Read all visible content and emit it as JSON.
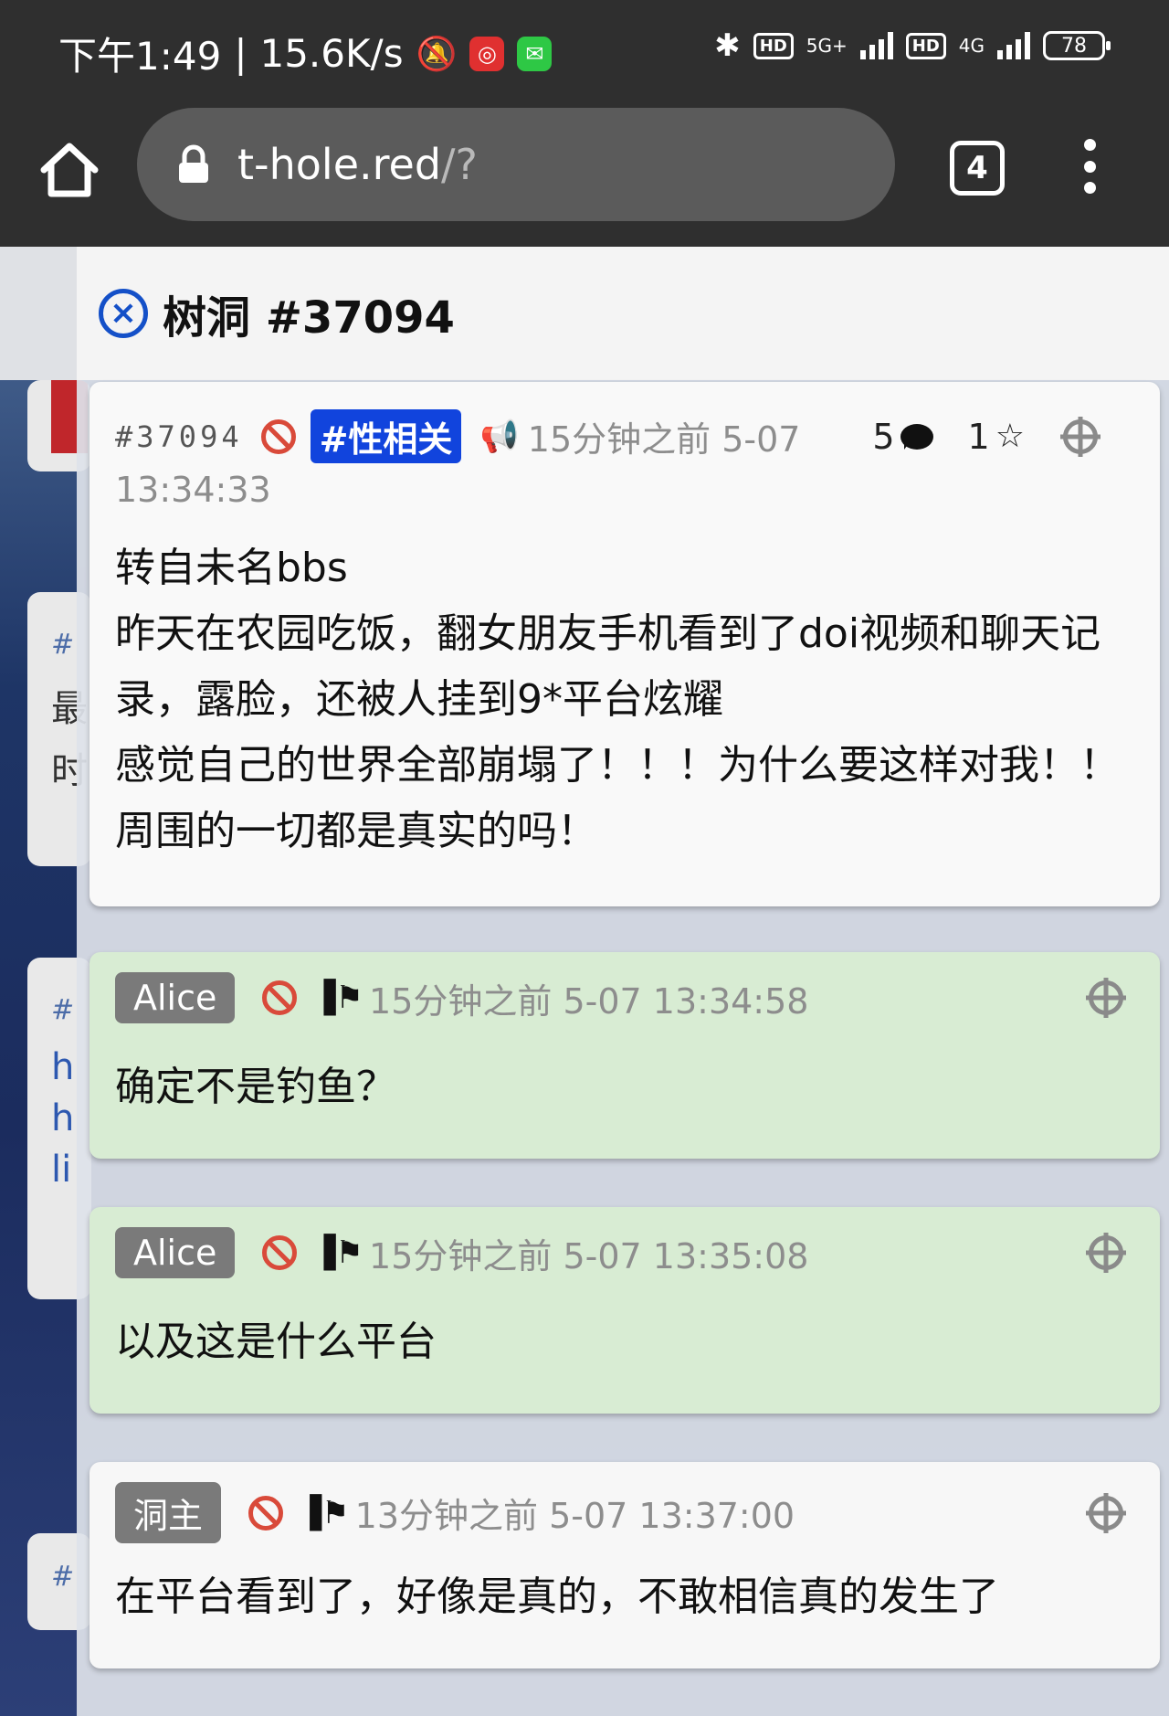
{
  "status_bar": {
    "time": "下午1:49",
    "speed": "15.6K/s",
    "network_5g": "5G+",
    "network_4g": "4G",
    "hd": "HD",
    "battery": "78"
  },
  "browser": {
    "url_host": "t-hole.red",
    "url_rest": "/?",
    "tab_count": "4"
  },
  "panel": {
    "title": "树洞 #37094"
  },
  "post": {
    "id": "#37094",
    "tag": "#性相关",
    "time_line1": "15分钟之前 5-07",
    "time_line2": "13:34:33",
    "reply_count": "5",
    "star_count": "1",
    "body": "转自未名bbs\n昨天在农园吃饭，翻女朋友手机看到了doi视频和聊天记录，露脸，还被人挂到9*平台炫耀\n感觉自己的世界全部崩塌了！！！为什么要这样对我！！周围的一切都是真实的吗！"
  },
  "replies": [
    {
      "author": "Alice",
      "time": "15分钟之前 5-07 13:34:58",
      "body": "确定不是钓鱼？"
    },
    {
      "author": "Alice",
      "time": "15分钟之前 5-07 13:35:08",
      "body": "以及这是什么平台"
    },
    {
      "author": "洞主",
      "time": "13分钟之前 5-07 13:37:00",
      "body": "在平台看到了，好像是真的，不敢相信真的发生了"
    }
  ],
  "background_cards": [
    {
      "hash": "#",
      "lines": [
        "最",
        "时"
      ]
    },
    {
      "hash": "#",
      "lines": [
        "h",
        "h",
        "li"
      ]
    },
    {
      "hash": "#",
      "lines": []
    }
  ],
  "colors": {
    "tag_bg": "#1144dd",
    "reply_bg": "#d8ecd3",
    "ban_red": "#d94a3a"
  }
}
